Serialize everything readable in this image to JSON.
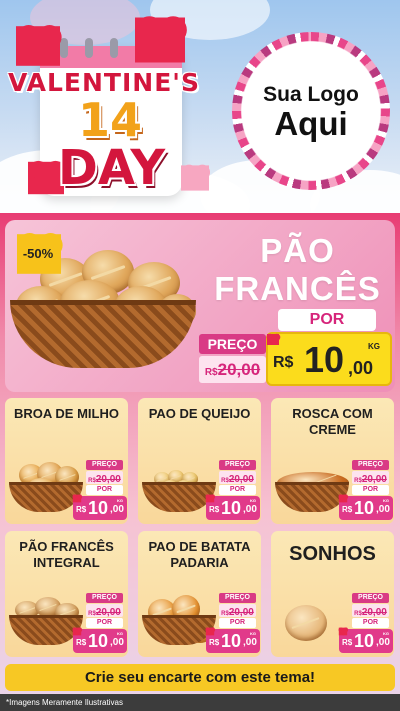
{
  "header": {
    "title_line1": "VALENTINE'S",
    "title_number": "14",
    "title_line2": "DAY",
    "logo_line1": "Sua Logo",
    "logo_line2": "Aqui"
  },
  "featured": {
    "discount": "-50%",
    "name_line1": "PÃO",
    "name_line2": "FRANCÊS",
    "por_label": "POR",
    "preco_label": "PREÇO",
    "old_currency": "R$",
    "old_value": "20,00",
    "new_currency": "R$",
    "new_int": "10",
    "new_dec": ",00",
    "unit": "KG"
  },
  "products": [
    {
      "name": "BROA DE MILHO",
      "preco_label": "PREÇO",
      "old_currency": "R$",
      "old_value": "20,00",
      "por_label": "POR",
      "new_currency": "R$",
      "new_int": "10",
      "new_dec": ",00",
      "unit": "KG"
    },
    {
      "name": "PAO DE QUEIJO",
      "preco_label": "PREÇO",
      "old_currency": "R$",
      "old_value": "20,00",
      "por_label": "POR",
      "new_currency": "R$",
      "new_int": "10",
      "new_dec": ",00",
      "unit": "KG"
    },
    {
      "name": "ROSCA COM CREME",
      "preco_label": "PREÇO",
      "old_currency": "R$",
      "old_value": "20,00",
      "por_label": "POR",
      "new_currency": "R$",
      "new_int": "10",
      "new_dec": ",00",
      "unit": "KG"
    },
    {
      "name": "PÃO FRANCÊS INTEGRAL",
      "preco_label": "PREÇO",
      "old_currency": "R$",
      "old_value": "20,00",
      "por_label": "POR",
      "new_currency": "R$",
      "new_int": "10",
      "new_dec": ",00",
      "unit": "KG"
    },
    {
      "name": "PAO DE BATATA PADARIA",
      "preco_label": "PREÇO",
      "old_currency": "R$",
      "old_value": "20,00",
      "por_label": "POR",
      "new_currency": "R$",
      "new_int": "10",
      "new_dec": ",00",
      "unit": "KG"
    },
    {
      "name": "SONHOS",
      "preco_label": "PREÇO",
      "old_currency": "R$",
      "old_value": "20,00",
      "por_label": "POR",
      "new_currency": "R$",
      "new_int": "10",
      "new_dec": ",00",
      "unit": "KG"
    }
  ],
  "footer": {
    "cta": "Crie seu encarte com este tema!",
    "disclaimer": "*Imagens Meramente Ilustrativas"
  },
  "colors": {
    "pink_primary": "#e13a8a",
    "yellow_price": "#fbdc1c",
    "title_red": "#d3163d",
    "card_bg": "#fbe8b6"
  },
  "icons": [
    "heart-icon",
    "calendar-icon",
    "bread-basket-image"
  ]
}
